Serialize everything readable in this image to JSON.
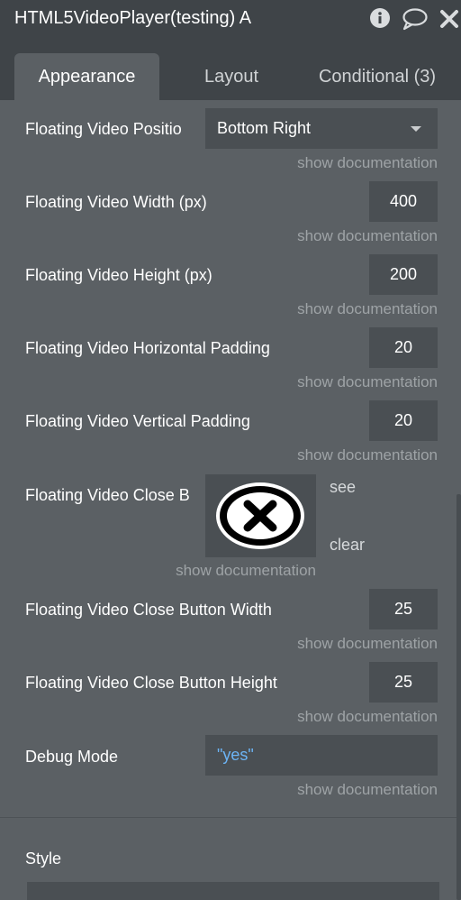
{
  "window": {
    "title": "HTML5VideoPlayer(testing) A"
  },
  "tabs": [
    {
      "label": "Appearance",
      "active": true
    },
    {
      "label": "Layout",
      "active": false
    },
    {
      "label": "Conditional (3)",
      "active": false
    }
  ],
  "fields": {
    "position": {
      "label": "Floating Video Positio",
      "value": "Bottom Right"
    },
    "width": {
      "label": "Floating Video Width (px)",
      "value": "400"
    },
    "height": {
      "label": "Floating Video Height (px)",
      "value": "200"
    },
    "hpad": {
      "label": "Floating Video Horizontal Padding",
      "value": "20"
    },
    "vpad": {
      "label": "Floating Video Vertical Padding",
      "value": "20"
    },
    "close_btn": {
      "label": "Floating Video Close B",
      "see": "see",
      "clear": "clear"
    },
    "close_w": {
      "label": "Floating Video Close Button Width",
      "value": "25"
    },
    "close_h": {
      "label": "Floating Video Close Button Height",
      "value": "25"
    },
    "debug": {
      "label": "Debug Mode",
      "value": "\"yes\""
    }
  },
  "show_documentation": "show documentation",
  "style_section": {
    "label": "Style"
  },
  "icons": [
    "info-icon",
    "comment-icon",
    "close-icon",
    "dropdown-caret-icon"
  ],
  "colors": {
    "panel": "#5b6064",
    "header": "#3f4448",
    "input": "#4a4f53",
    "doc_link": "#9ea3a6",
    "dynamic_value": "#6cb4f5"
  }
}
